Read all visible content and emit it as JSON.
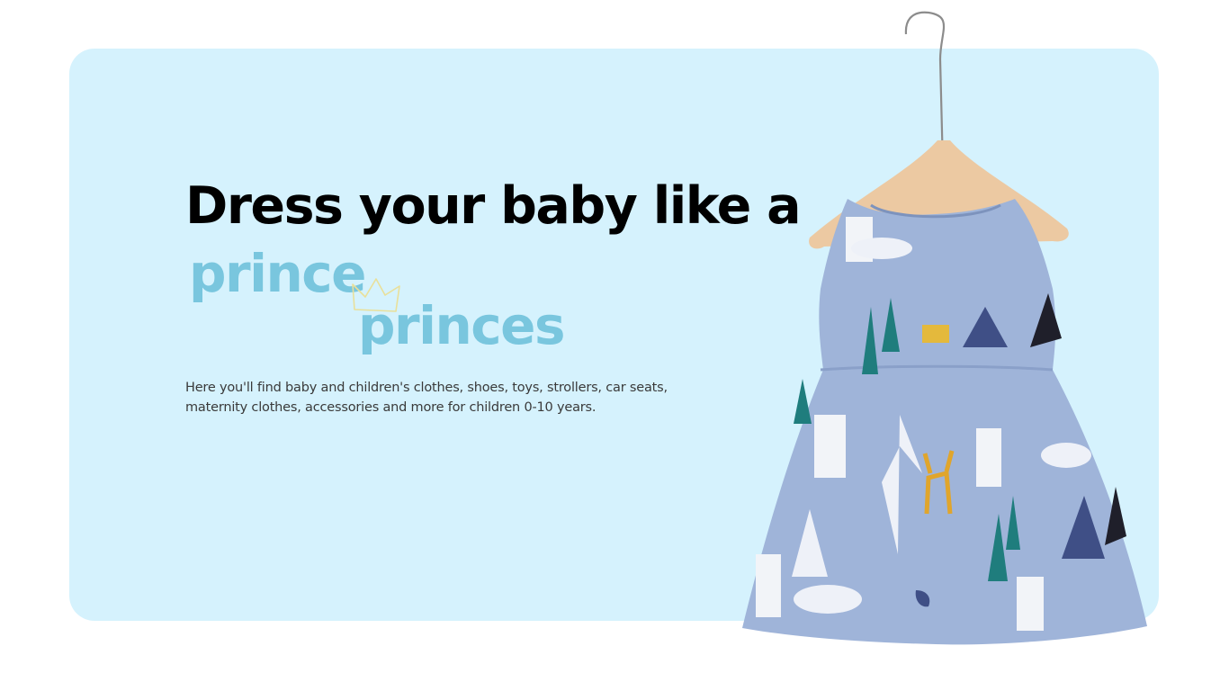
{
  "hero": {
    "headline": "Dress your baby like a",
    "word1": "prince",
    "word2": "princes",
    "description": "Here you'll find baby and children's clothes, shoes, toys, strollers, car seats, maternity clothes, accessories and more for children 0-10 years."
  },
  "colors": {
    "card_background": "#d5f2fd",
    "accent": "#79c6de",
    "headline": "#000000",
    "dress": "#9fb4d9"
  },
  "icons": {
    "crown": "crown-icon",
    "product": "dress-on-hanger"
  }
}
